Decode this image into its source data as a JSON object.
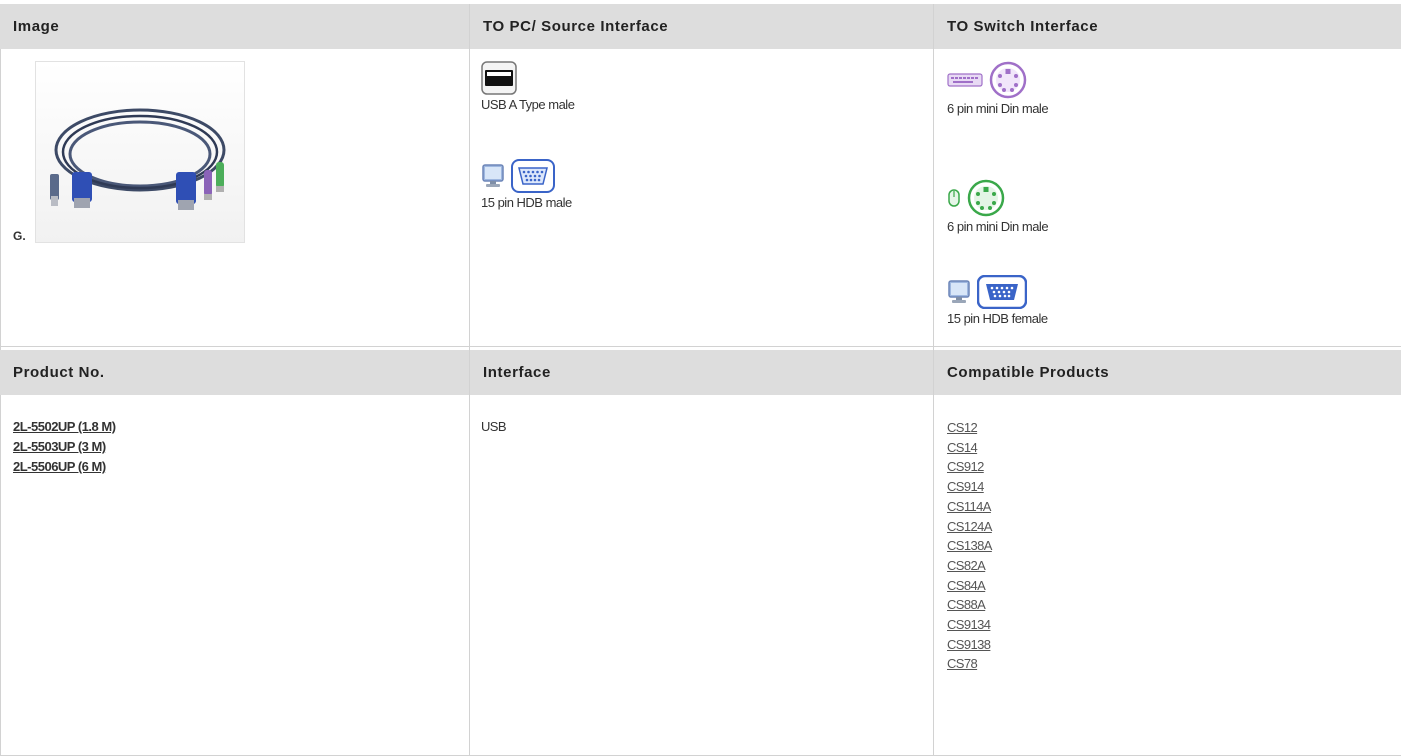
{
  "header_row_1": {
    "image": "Image",
    "to_pc": "TO PC/ Source Interface",
    "to_switch": "TO Switch Interface"
  },
  "image_cell": {
    "label": "G."
  },
  "to_pc_items": [
    {
      "label": "USB A Type male",
      "icons": [
        "usb-a-connector-icon"
      ]
    },
    {
      "label": "15 pin HDB male",
      "icons": [
        "monitor-icon",
        "vga-connector-icon"
      ]
    }
  ],
  "to_switch_items": [
    {
      "label": "6 pin mini Din male",
      "icons": [
        "keyboard-icon",
        "ps2-connector-purple-icon"
      ]
    },
    {
      "label": "6 pin mini Din male",
      "icons": [
        "mouse-icon",
        "ps2-connector-green-icon"
      ]
    },
    {
      "label": "15 pin HDB female",
      "icons": [
        "monitor-icon",
        "vga-connector-icon"
      ]
    }
  ],
  "header_row_2": {
    "product_no": "Product No.",
    "interface": "Interface",
    "compatible": "Compatible Products"
  },
  "products": [
    "2L-5502UP (1.8 M)",
    "2L-5503UP (3 M)",
    "2L-5506UP (6 M)"
  ],
  "interface_value": "USB",
  "compatible_products": [
    "CS12",
    "CS14",
    "CS912",
    "CS914",
    "CS114A",
    "CS124A",
    "CS138A",
    "CS82A",
    "CS84A",
    "CS88A",
    "CS9134",
    "CS9138",
    "CS78"
  ],
  "colors": {
    "header_bg": "#dddddd",
    "border": "#d2d2d2",
    "vga_blue": "#3a64c8",
    "ps2_purple": "#a070c8",
    "ps2_green": "#3aa84a"
  }
}
